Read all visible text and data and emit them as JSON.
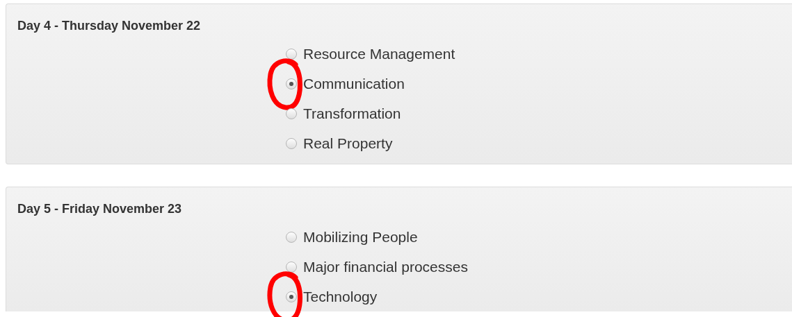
{
  "days": [
    {
      "title": "Day 4 - Thursday November 22",
      "options": [
        {
          "label": "Resource Management",
          "selected": false,
          "circled": false
        },
        {
          "label": "Communication",
          "selected": true,
          "circled": true
        },
        {
          "label": "Transformation",
          "selected": false,
          "circled": false
        },
        {
          "label": "Real Property",
          "selected": false,
          "circled": false
        }
      ]
    },
    {
      "title": "Day 5 - Friday November 23",
      "options": [
        {
          "label": "Mobilizing People",
          "selected": false,
          "circled": false
        },
        {
          "label": "Major financial processes",
          "selected": false,
          "circled": false
        },
        {
          "label": "Technology",
          "selected": true,
          "circled": true
        }
      ]
    }
  ]
}
